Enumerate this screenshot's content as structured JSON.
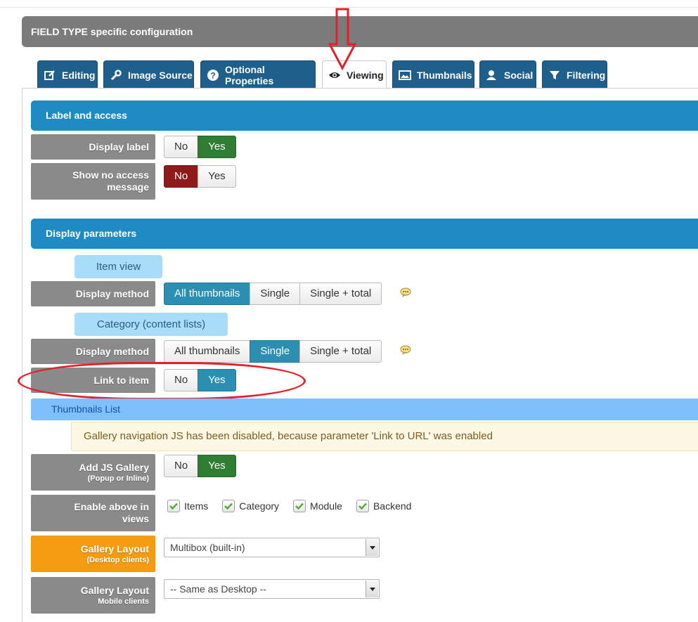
{
  "header": {
    "title": "FIELD TYPE specific configuration"
  },
  "tabs": [
    {
      "label": "Editing",
      "icon": "edit-icon"
    },
    {
      "label": "Image Source",
      "icon": "wrench-icon"
    },
    {
      "label": "Optional Properties",
      "icon": "question-icon"
    },
    {
      "label": "Viewing",
      "icon": "eye-icon",
      "active": true
    },
    {
      "label": "Thumbnails",
      "icon": "image-icon"
    },
    {
      "label": "Social",
      "icon": "user-icon"
    },
    {
      "label": "Filtering",
      "icon": "filter-icon"
    }
  ],
  "label_access": {
    "title": "Label and access",
    "display_label": {
      "label": "Display label",
      "no": "No",
      "yes": "Yes",
      "selected": "Yes"
    },
    "show_no_access": {
      "label_line1": "Show no access",
      "label_line2": "message",
      "no": "No",
      "yes": "Yes",
      "selected": "No"
    }
  },
  "display_params": {
    "title": "Display parameters",
    "item_view": {
      "pill": "Item view",
      "label": "Display method",
      "options": [
        "All thumbnails",
        "Single",
        "Single + total"
      ],
      "selected": "All thumbnails"
    },
    "category_view": {
      "pill": "Category (content lists)",
      "label": "Display method",
      "options": [
        "All thumbnails",
        "Single",
        "Single + total"
      ],
      "selected": "Single"
    },
    "link_to_item": {
      "label": "Link to item",
      "no": "No",
      "yes": "Yes",
      "selected": "Yes"
    }
  },
  "thumbnails_list": {
    "title": "Thumbnails List",
    "notice": "Gallery navigation JS has been disabled, because parameter 'Link to URL' was enabled",
    "add_js_gallery": {
      "label": "Add JS Gallery",
      "sub": "(Popup or Inline)",
      "no": "No",
      "yes": "Yes",
      "selected": "Yes"
    },
    "enable_above": {
      "label_line1": "Enable above in",
      "label_line2": "views",
      "options": [
        "Items",
        "Category",
        "Module",
        "Backend"
      ]
    },
    "gallery_layout_desktop": {
      "label": "Gallery Layout",
      "sub": "(Desktop clients)",
      "value": "Multibox (built-in)"
    },
    "gallery_layout_mobile": {
      "label": "Gallery Layout",
      "sub": "Mobile clients",
      "value": "-- Same as Desktop --"
    }
  },
  "colors": {
    "section_blue": "#1e8bc3",
    "tab_dark_blue": "#1f5f8b",
    "yes_green": "#2e7d32",
    "no_red": "#8e1b1b",
    "selected_teal": "#2a8fb0",
    "annotation_red": "#e3202a"
  }
}
